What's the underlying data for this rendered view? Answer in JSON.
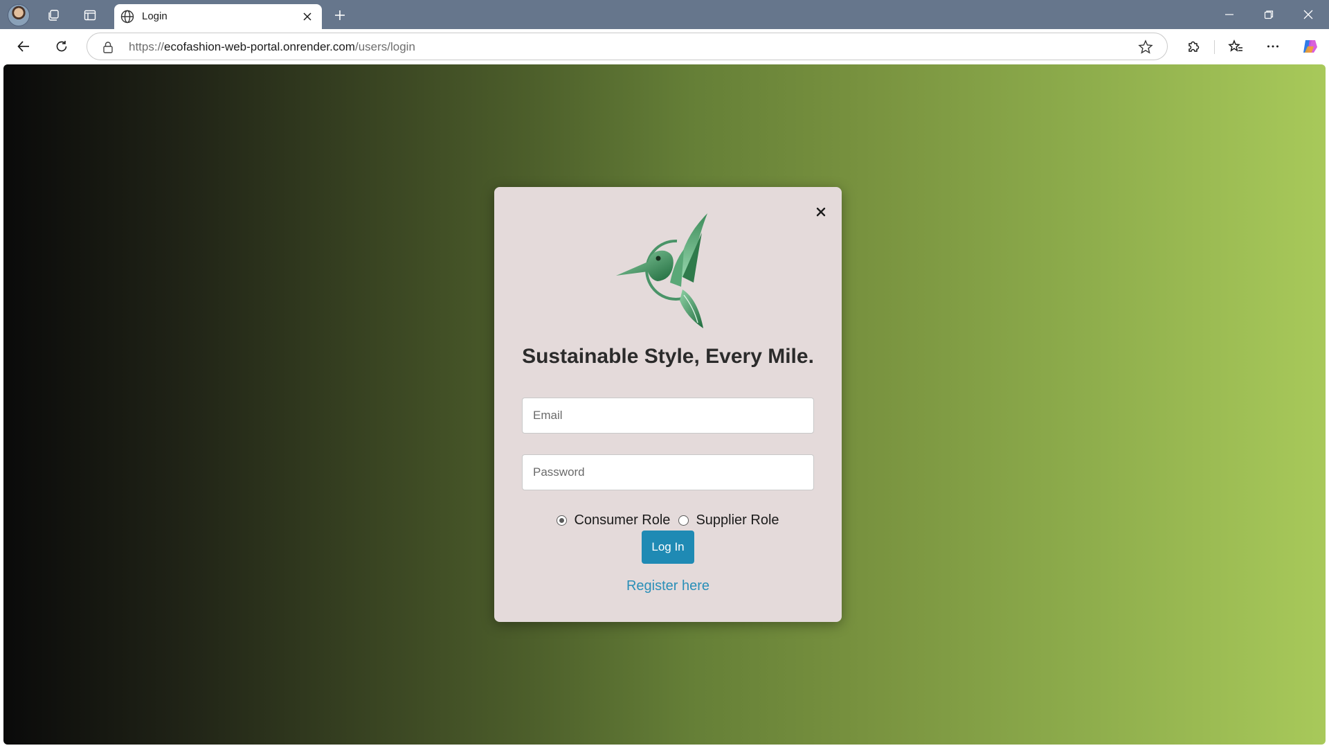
{
  "browser": {
    "tab": {
      "title": "Login"
    },
    "url": {
      "protocol": "https://",
      "host": "ecofashion-web-portal.onrender.com",
      "path": "/users/login"
    },
    "icons": {
      "profile": "profile-avatar",
      "workspaces": "workspaces-icon",
      "tab_actions": "vertical-tabs-icon",
      "globe": "globe-icon",
      "close_tab": "close-icon",
      "new_tab": "plus-icon",
      "minimize": "minimize-icon",
      "restore": "restore-icon",
      "close_window": "close-icon",
      "back": "back-arrow-icon",
      "refresh": "refresh-icon",
      "lock": "lock-icon",
      "favorite": "star-icon",
      "extensions": "puzzle-icon",
      "favorites_list": "favorites-icon",
      "menu": "more-icon",
      "copilot": "copilot-icon"
    }
  },
  "login": {
    "headline": "Sustainable Style, Every Mile.",
    "email_placeholder": "Email",
    "password_placeholder": "Password",
    "roles": [
      {
        "label": "Consumer Role",
        "checked": true
      },
      {
        "label": "Supplier Role",
        "checked": false
      }
    ],
    "submit_label": "Log In",
    "register_label": "Register here",
    "logo": "hummingbird-logo"
  },
  "colors": {
    "tabbar": "#66768c",
    "modal_bg": "#e4dada",
    "button": "#1f8ab4",
    "link": "#2a8fb8",
    "gradient_start": "#0a0a0a",
    "gradient_end": "#a8c95a"
  }
}
